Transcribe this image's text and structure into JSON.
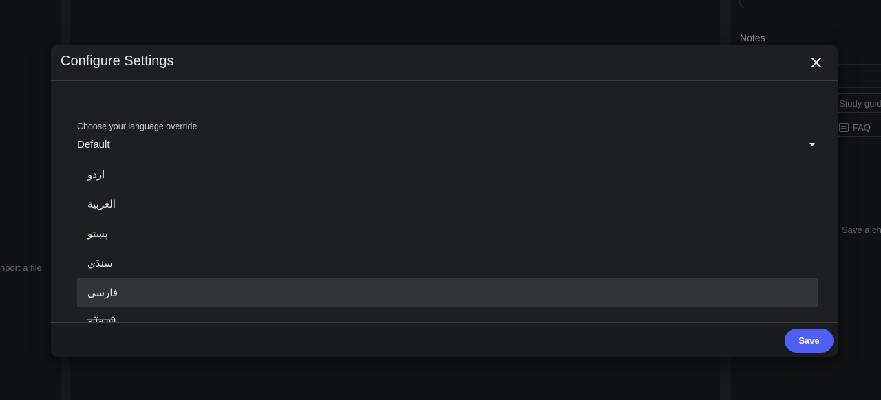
{
  "background": {
    "left_panel": {
      "import_hint": "nport a file"
    },
    "right_panel": {
      "notes_title": "Notes",
      "chips": [
        {
          "label": "Study guid",
          "icon": ""
        },
        {
          "label": "FAQ",
          "icon": "faq-icon"
        }
      ],
      "save_chat_hint": "Save a cha"
    }
  },
  "dialog": {
    "title": "Configure Settings",
    "close_icon": "close-icon",
    "language_field": {
      "label": "Choose your language override",
      "value": "Default",
      "options": [
        {
          "label": "اردو",
          "selected": false
        },
        {
          "label": "العربية",
          "selected": false
        },
        {
          "label": "پښتو",
          "selected": false
        },
        {
          "label": "سنڌي",
          "selected": false
        },
        {
          "label": "فارسی",
          "selected": true
        },
        {
          "label": "कोंकणी",
          "selected": false
        }
      ]
    },
    "save_label": "Save"
  },
  "colors": {
    "accent": "#4f5ff6",
    "dialog_bg": "#1e1f20",
    "page_bg": "#131417",
    "selected_option_bg": "#333436"
  }
}
